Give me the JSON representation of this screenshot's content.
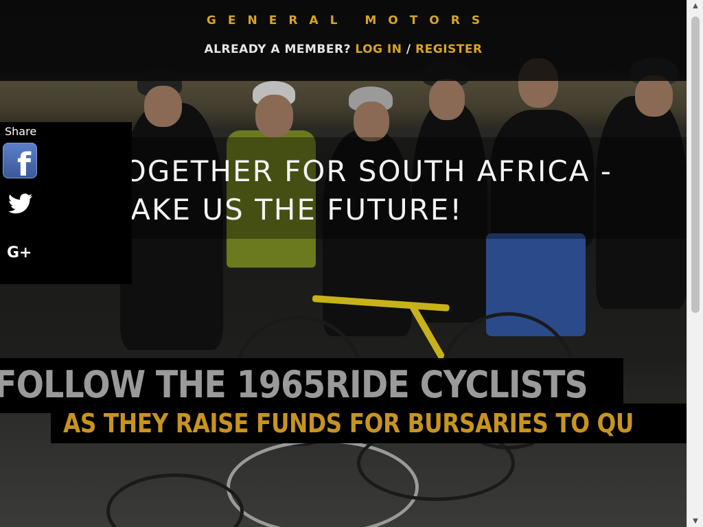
{
  "header": {
    "brand": "GENERAL MOTORS",
    "member_prompt": "ALREADY A MEMBER?",
    "login_label": "LOG IN",
    "separator": "/",
    "register_label": "REGISTER"
  },
  "hero": {
    "headline_line1": "TOGETHER FOR SOUTH AFRICA -",
    "headline_line2": "MAKE US THE FUTURE!",
    "banner_line1": "FOLLOW THE 1965RIDE CYCLISTS",
    "banner_line2": "AS THEY RAISE FUNDS FOR BURSARIES TO QU"
  },
  "share": {
    "title": "Share",
    "facebook_glyph": "f",
    "googleplus_glyph": "G+",
    "icons": [
      "facebook-icon",
      "twitter-icon",
      "google-plus-icon"
    ]
  },
  "colors": {
    "accent": "#d9a522",
    "banner_gold": "#c7941f",
    "banner_grey": "#9a9a9a",
    "facebook": "#3b5998"
  }
}
